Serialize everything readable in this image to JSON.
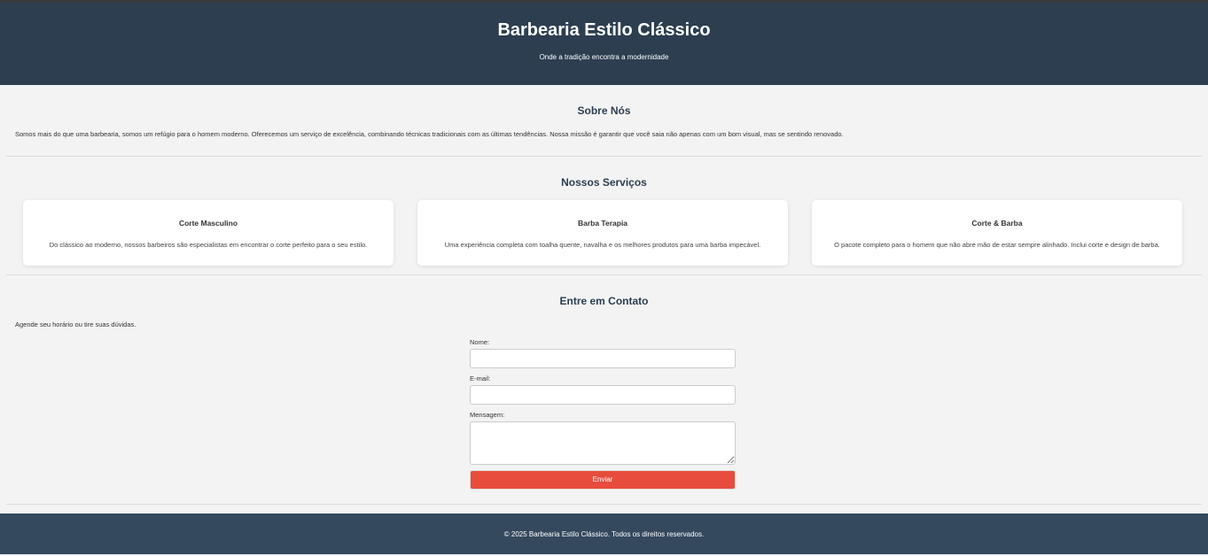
{
  "header": {
    "title": "Barbearia Estilo Clássico",
    "subtitle": "Onde a tradição encontra a modernidade"
  },
  "about": {
    "title": "Sobre Nós",
    "text": "Somos mais do que uma barbearia, somos um refúgio para o homem moderno. Oferecemos um serviço de excelência, combinando técnicas tradicionais com as últimas tendências. Nossa missão é garantir que você saia não apenas com um bom visual, mas se sentindo renovado."
  },
  "services": {
    "title": "Nossos Serviços",
    "items": [
      {
        "title": "Corte Masculino",
        "text": "Do clássico ao moderno, nossos barbeiros são especialistas em encontrar o corte perfeito para o seu estilo."
      },
      {
        "title": "Barba Terapia",
        "text": "Uma experiência completa com toalha quente, navalha e os melhores produtos para uma barba impecável."
      },
      {
        "title": "Corte & Barba",
        "text": "O pacote completo para o homem que não abre mão de estar sempre alinhado. Inclui corte e design de barba."
      }
    ]
  },
  "contact": {
    "title": "Entre em Contato",
    "text": "Agende seu horário ou tire suas dúvidas.",
    "name_label": "Nome:",
    "email_label": "E-mail:",
    "message_label": "Mensagem:",
    "name_value": "",
    "email_value": "",
    "message_value": "",
    "submit": "Enviar"
  },
  "footer": {
    "text": "© 2025 Barbearia Estilo Clássico. Todos os direitos reservados."
  },
  "colors": {
    "header": "#2c3e50",
    "footer": "#34495e",
    "button": "#e74c3c"
  }
}
